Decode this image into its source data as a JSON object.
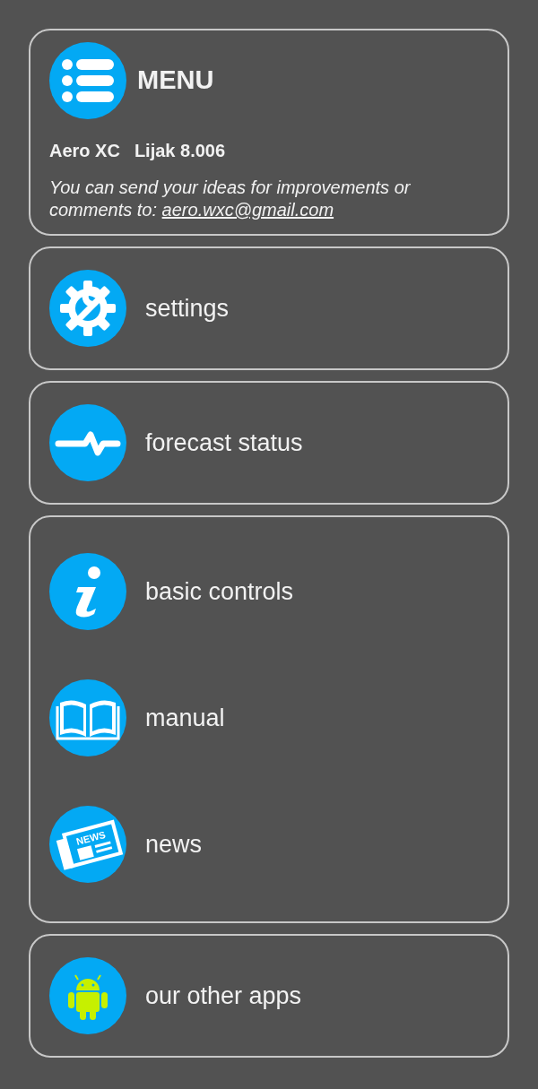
{
  "header": {
    "title": "MENU",
    "app_name": "Aero XC",
    "version": "Lijak 8.006",
    "message": "You can send your ideas for improvements or comments to:",
    "email": "aero.wxc@gmail.com"
  },
  "groups": [
    {
      "items": [
        {
          "kind": "settings",
          "label": "settings"
        }
      ]
    },
    {
      "items": [
        {
          "kind": "pulse",
          "label": "forecast status"
        }
      ]
    },
    {
      "items": [
        {
          "kind": "info",
          "label": "basic controls"
        },
        {
          "kind": "book",
          "label": "manual"
        },
        {
          "kind": "news",
          "label": "news",
          "icon_text": "NEWS"
        }
      ]
    },
    {
      "items": [
        {
          "kind": "android",
          "label": "our other apps"
        }
      ]
    }
  ]
}
